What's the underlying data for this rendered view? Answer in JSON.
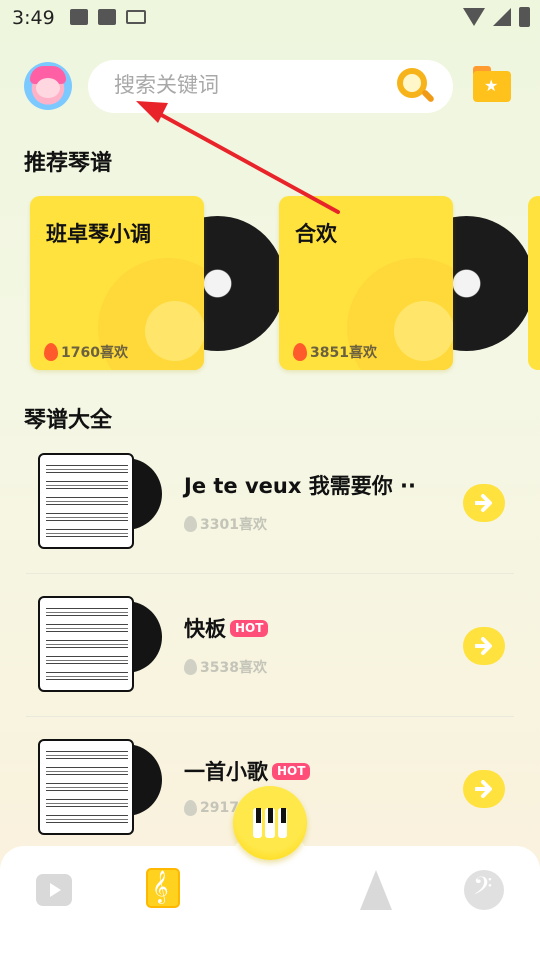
{
  "status_bar": {
    "time": "3:49",
    "left_icons": [
      "image-icon",
      "a-icon",
      "keyboard-icon"
    ],
    "right_icons": [
      "wifi-icon",
      "signal-icon",
      "battery-icon"
    ]
  },
  "header": {
    "avatar": "avatar",
    "search_placeholder": "搜索关键词",
    "search_icon": "search-icon",
    "folder_icon": "folder-star-icon"
  },
  "recommended": {
    "title": "推荐琴谱",
    "items": [
      {
        "title": "班卓琴小调",
        "likes": "1760喜欢"
      },
      {
        "title": "合欢",
        "likes": "3851喜欢"
      }
    ]
  },
  "library": {
    "title": "琴谱大全",
    "items": [
      {
        "title": "Je  te  veux  我需要你 ··",
        "hot": "",
        "likes": "3301喜欢"
      },
      {
        "title": "快板",
        "hot": "HOT",
        "likes": "3538喜欢"
      },
      {
        "title": "一首小歌",
        "hot": "HOT",
        "likes": "2917"
      }
    ]
  },
  "bottom_nav": {
    "items": [
      "video-play-icon",
      "music-score-book-icon",
      "piano-keys-icon",
      "metronome-icon",
      "bass-clef-icon"
    ]
  },
  "colors": {
    "accent_yellow": "#ffe23d",
    "hot_pink": "#ff4f79",
    "annotation_red": "#e8242a"
  }
}
